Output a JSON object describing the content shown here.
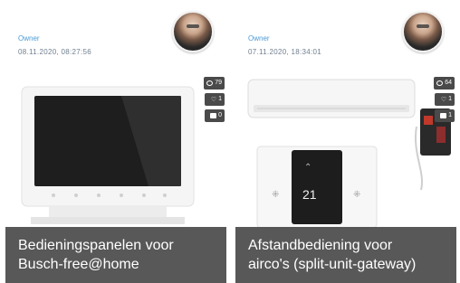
{
  "cards": [
    {
      "author_label": "Owner",
      "timestamp": "08.11.2020, 08:27:56",
      "stats": {
        "views": "79",
        "likes": "1",
        "comments": "0"
      },
      "caption_line1": "Bedieningspanelen voor",
      "caption_line2": "Busch-free@home",
      "image_icon": "indoor-video-panel"
    },
    {
      "author_label": "Owner",
      "timestamp": "07.11.2020, 18:34:01",
      "stats": {
        "views": "64",
        "likes": "1",
        "comments": "1"
      },
      "caption_line1": "Afstandbediening voor",
      "caption_line2": "airco's (split-unit-gateway)",
      "image_icon": "air-conditioner-with-thermostat"
    }
  ],
  "colors": {
    "caption_bg": "#464646",
    "author_label": "#4a9ad6",
    "badge_bg": "#4a4a4a"
  }
}
